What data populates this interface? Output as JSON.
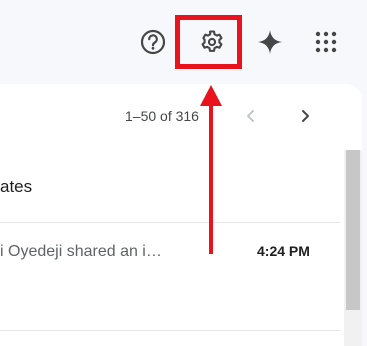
{
  "toolbar": {
    "icons": [
      "help-icon",
      "settings-icon",
      "gemini-sparkle-icon",
      "apps-grid-icon"
    ]
  },
  "pager": {
    "range_text": "1–50 of 316"
  },
  "inbox": {
    "tab_label_partial": "ates",
    "rows": [
      {
        "sender_snippet": "i Oyedeji shared an i…",
        "time": "4:24 PM"
      }
    ]
  },
  "annotation": {
    "highlight_color": "#e8131d",
    "target": "settings-icon"
  },
  "colors": {
    "background": "#f6f8fc",
    "panel": "#ffffff",
    "icon": "#444746"
  }
}
